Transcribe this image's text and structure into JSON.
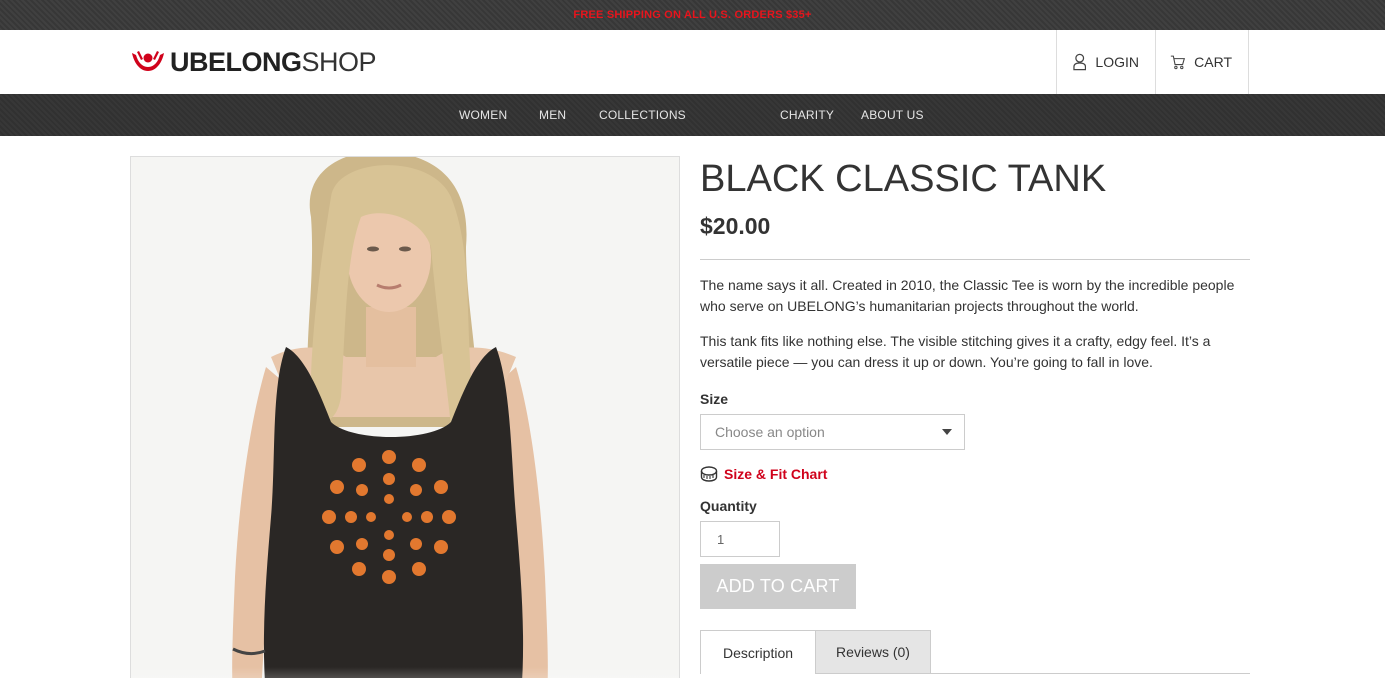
{
  "promo": {
    "text": "FREE SHIPPING ON ALL U.S. ORDERS $35+"
  },
  "header": {
    "logo_bold": "UBELONG",
    "logo_light": "SHOP",
    "login_label": "LOGIN",
    "cart_label": "CART"
  },
  "nav": {
    "items": [
      {
        "label": "WOMEN"
      },
      {
        "label": "MEN"
      },
      {
        "label": "COLLECTIONS"
      },
      {
        "label": "CHARITY"
      },
      {
        "label": "ABOUT US"
      }
    ]
  },
  "product": {
    "title": "BLACK CLASSIC TANK",
    "price": "$20.00",
    "description_1": "The name says it all. Created in 2010, the Classic Tee is worn by the incredible people who serve on UBELONG’s humanitarian projects throughout the world.",
    "description_2": "This tank fits like nothing else. The visible stitching gives it a crafty, edgy feel. It’s a versatile piece — you can dress it up or down. You’re going to fall in love.",
    "size_label": "Size",
    "size_placeholder": "Choose an option",
    "fit_chart_label": "Size & Fit Chart",
    "quantity_label": "Quantity",
    "quantity_value": "1",
    "add_to_cart_label": "ADD TO CART"
  },
  "tabs": [
    {
      "label": "Description"
    },
    {
      "label": "Reviews (0)"
    }
  ],
  "colors": {
    "brand_red": "#d0021b",
    "nav_bg": "#333333",
    "button_disabled": "#cccccc"
  },
  "icons": {
    "logo": "ubelong-logo-icon",
    "login": "user-icon",
    "cart": "cart-icon",
    "fit": "measuring-tape-icon",
    "select": "caret-down-icon"
  }
}
